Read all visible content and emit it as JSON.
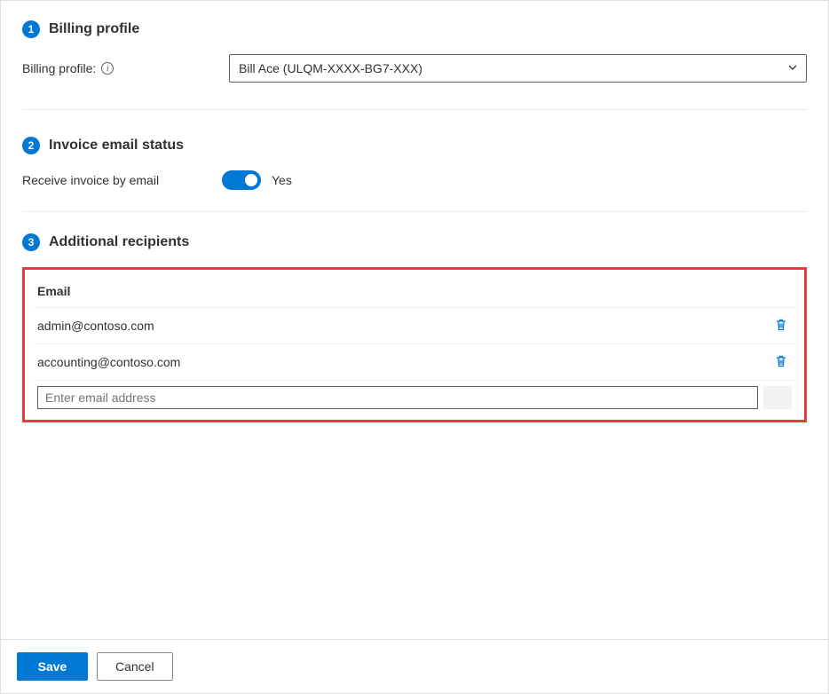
{
  "colors": {
    "accent": "#0078d4",
    "highlight_border": "#e83b3b"
  },
  "section1": {
    "step": "1",
    "title": "Billing profile",
    "field_label": "Billing profile:",
    "selected_value": "Bill Ace (ULQM-XXXX-BG7-XXX)"
  },
  "section2": {
    "step": "2",
    "title": "Invoice email status",
    "field_label": "Receive invoice by email",
    "toggle_on": true,
    "toggle_label": "Yes"
  },
  "section3": {
    "step": "3",
    "title": "Additional recipients",
    "table_header": "Email",
    "rows": [
      {
        "email": "admin@contoso.com"
      },
      {
        "email": "accounting@contoso.com"
      }
    ],
    "input_placeholder": "Enter email address"
  },
  "footer": {
    "save_label": "Save",
    "cancel_label": "Cancel"
  }
}
